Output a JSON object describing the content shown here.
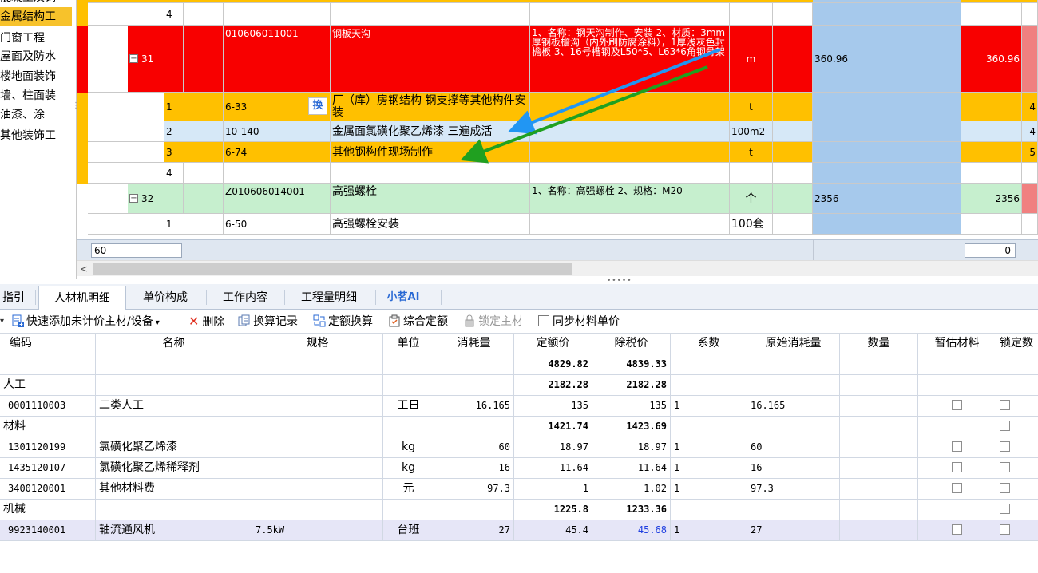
{
  "left_tree": {
    "items": [
      {
        "label": "混凝土及钢"
      },
      {
        "label": "金属结构工"
      },
      {
        "label": "门窗工程"
      },
      {
        "label": "屋面及防水"
      },
      {
        "label": "楼地面装饰"
      },
      {
        "label": "墙、柱面装"
      },
      {
        "label": "油漆、涂"
      },
      {
        "label": "其他装饰工"
      }
    ]
  },
  "grid": {
    "rows": [
      {
        "seq": "4",
        "code": "",
        "name": "",
        "desc": "",
        "unit": "",
        "qty": "",
        "total": ""
      },
      {
        "seq": "31",
        "code": "010606011001",
        "name": "钢板天沟",
        "desc": "1、名称：钢天沟制作、安装 2、材质：3mm厚钢板檐沟（内外刷防腐涂料），1厚浅灰色封檐板 3、16号槽钢及L50*5、L63*6角钢骨架",
        "unit": "m",
        "qty": "360.96",
        "total": "360.96"
      },
      {
        "seq": "1",
        "code": "6-33",
        "name": "厂（库）房钢结构 钢支撑等其他构件安装",
        "swap": "换",
        "desc": "",
        "unit": "t",
        "qty": "",
        "total": "4"
      },
      {
        "seq": "2",
        "code": "10-140",
        "name": "金属面氯磺化聚乙烯漆 三遍成活",
        "desc": "",
        "unit": "100m2",
        "qty": "",
        "total": "4"
      },
      {
        "seq": "3",
        "code": "6-74",
        "name": "其他钢构件现场制作",
        "desc": "",
        "unit": "t",
        "qty": "",
        "total": "5"
      },
      {
        "seq": "4",
        "code": "",
        "name": "",
        "desc": "",
        "unit": "",
        "qty": "",
        "total": ""
      },
      {
        "seq": "32",
        "code": "Z010606014001",
        "name": "高强螺栓",
        "desc": "1、名称：高强螺栓 2、规格：M20",
        "unit": "个",
        "qty": "2356",
        "total": "2356"
      },
      {
        "seq": "1",
        "code": "6-50",
        "name": "高强螺栓安装",
        "desc": "",
        "unit": "100套",
        "qty": "",
        "total": ""
      }
    ],
    "footer_input_a": "60",
    "footer_input_b": "0"
  },
  "tabs": [
    "指引",
    "人材机明细",
    "单价构成",
    "工作内容",
    "工程量明细",
    "小茗AI"
  ],
  "active_tab": "人材机明细",
  "toolbar": {
    "quick_add": "快速添加未计价主材/设备",
    "delete": "删除",
    "swap_record": "换算记录",
    "quota_swap": "定额换算",
    "composite_quota": "综合定额",
    "lock_main": "锁定主材",
    "sync_price": "同步材料单价"
  },
  "detail": {
    "columns": [
      "编码",
      "名称",
      "规格",
      "单位",
      "消耗量",
      "定额价",
      "除税价",
      "系数",
      "原始消耗量",
      "数量",
      "暂估材料",
      "锁定数"
    ],
    "rows": [
      {
        "type": "total",
        "code": "",
        "name": "",
        "spec": "",
        "unit": "",
        "consume": "",
        "quota": "4829.82",
        "tax_free": "4839.33",
        "coef": "",
        "orig": "",
        "amount": "",
        "est": false,
        "lock": false
      },
      {
        "type": "group",
        "code": "人工",
        "name": "",
        "spec": "",
        "unit": "",
        "consume": "",
        "quota": "2182.28",
        "tax_free": "2182.28",
        "coef": "",
        "orig": "",
        "amount": "",
        "est": false,
        "lock": false
      },
      {
        "type": "item",
        "code": "0001110003",
        "name": "二类人工",
        "spec": "",
        "unit": "工日",
        "consume": "16.165",
        "quota": "135",
        "tax_free": "135",
        "coef": "1",
        "orig": "16.165",
        "amount": "",
        "est": true,
        "lock": true
      },
      {
        "type": "group",
        "code": "材料",
        "name": "",
        "spec": "",
        "unit": "",
        "consume": "",
        "quota": "1421.74",
        "tax_free": "1423.69",
        "coef": "",
        "orig": "",
        "amount": "",
        "est": false,
        "lock": true
      },
      {
        "type": "item",
        "code": "1301120199",
        "name": "氯磺化聚乙烯漆",
        "spec": "",
        "unit": "kg",
        "consume": "60",
        "quota": "18.97",
        "tax_free": "18.97",
        "coef": "1",
        "orig": "60",
        "amount": "",
        "est": true,
        "lock": true
      },
      {
        "type": "item",
        "code": "1435120107",
        "name": "氯磺化聚乙烯稀释剂",
        "spec": "",
        "unit": "kg",
        "consume": "16",
        "quota": "11.64",
        "tax_free": "11.64",
        "coef": "1",
        "orig": "16",
        "amount": "",
        "est": true,
        "lock": true
      },
      {
        "type": "item",
        "code": "3400120001",
        "name": "其他材料费",
        "spec": "",
        "unit": "元",
        "consume": "97.3",
        "quota": "1",
        "tax_free": "1.02",
        "coef": "1",
        "orig": "97.3",
        "amount": "",
        "est": true,
        "lock": true
      },
      {
        "type": "group",
        "code": "机械",
        "name": "",
        "spec": "",
        "unit": "",
        "consume": "",
        "quota": "1225.8",
        "tax_free": "1233.36",
        "coef": "",
        "orig": "",
        "amount": "",
        "est": false,
        "lock": true
      },
      {
        "type": "item",
        "code": "9923140001",
        "name": "轴流通风机",
        "spec": "7.5kW",
        "unit": "台班",
        "consume": "27",
        "quota": "45.4",
        "tax_free": "45.68",
        "coef": "1",
        "orig": "27",
        "amount": "",
        "est": true,
        "lock": true
      }
    ]
  },
  "colors": {
    "red_row": "#f80000",
    "orange_row": "#ffc000",
    "blue_row": "#d6e8f7",
    "green_row": "#c6efce",
    "blue_arrow": "#2196f3",
    "green_arrow": "#20a020"
  }
}
